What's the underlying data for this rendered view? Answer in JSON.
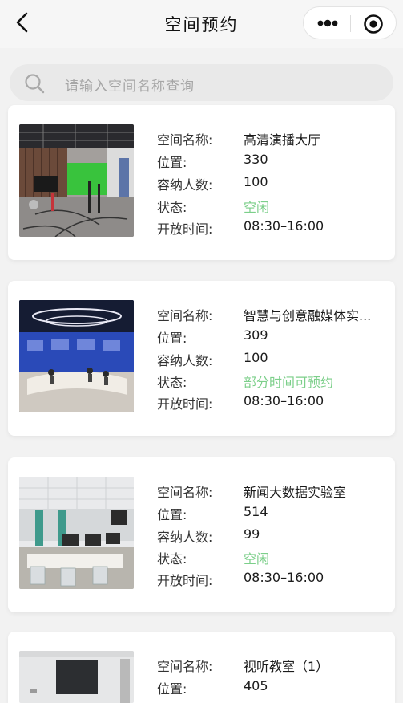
{
  "header": {
    "title": "空间预约"
  },
  "search": {
    "placeholder": "请输入空间名称查询"
  },
  "labels": {
    "name": "空间名称:",
    "location": "位置:",
    "capacity": "容纳人数:",
    "status": "状态:",
    "hours": "开放时间:"
  },
  "spaces": [
    {
      "name": "高清演播大厅",
      "location": "330",
      "capacity": "100",
      "status": "空闲",
      "hours": "08:30–16:00"
    },
    {
      "name": "智慧与创意融媒体实...",
      "location": "309",
      "capacity": "100",
      "status": "部分时间可预约",
      "hours": "08:30–16:00"
    },
    {
      "name": "新闻大数据实验室",
      "location": "514",
      "capacity": "99",
      "status": "空闲",
      "hours": "08:30–16:00"
    },
    {
      "name": "视听教室（1）",
      "location": "405",
      "capacity": "",
      "status": "",
      "hours": ""
    }
  ],
  "colors": {
    "status_available": "#7ccf8a"
  },
  "icons": [
    "back-arrow-icon",
    "more-dots-icon",
    "close-circle-icon",
    "search-icon"
  ]
}
